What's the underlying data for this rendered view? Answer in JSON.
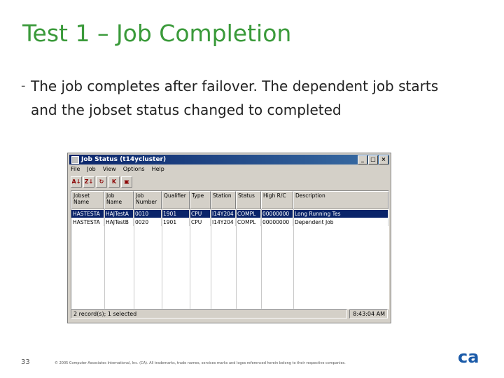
{
  "slide": {
    "title": "Test 1 – Job Completion",
    "bullet_dash": "-",
    "bullet_text": "The job completes after failover. The dependent job starts and the jobset status changed to completed",
    "page_number": "33",
    "copyright": "© 2005 Computer Associates International, Inc. (CA). All trademarks, trade names, services marks and logos referenced herein belong to their respective companies.",
    "logo_text": "ca",
    "logo_color": "#1a5aa8"
  },
  "window": {
    "title": "Job Status (t14ycluster)",
    "buttons": {
      "minimize": "_",
      "maximize": "□",
      "close": "×"
    },
    "menu": [
      "File",
      "Job",
      "View",
      "Options",
      "Help"
    ],
    "toolbar": [
      {
        "icon": "sort-asc-icon",
        "glyph": "A↓"
      },
      {
        "icon": "sort-desc-icon",
        "glyph": "Z↓"
      },
      {
        "icon": "refresh-icon",
        "glyph": "↻"
      },
      {
        "icon": "cancel-icon",
        "glyph": "K"
      },
      {
        "icon": "save-icon",
        "glyph": "▣"
      }
    ],
    "columns": [
      "Jobset Name",
      "Job Name",
      "Job Number",
      "Qualifier",
      "Type",
      "Station",
      "Status",
      "High R/C",
      "Description"
    ],
    "rows": [
      [
        "HASTESTA",
        "HAJTestA",
        "0010",
        "1901",
        "CPU",
        "I14Y204",
        "COMPL",
        "00000000",
        "Long Running Tes"
      ],
      [
        "HASTESTA",
        "HAJTestB",
        "0020",
        "1901",
        "CPU",
        "I14Y204",
        "COMPL",
        "00000000",
        "Dependent Job"
      ]
    ],
    "selected_row": 0,
    "status_left": "2 record(s); 1 selected",
    "status_right": "8:43:04 AM"
  }
}
